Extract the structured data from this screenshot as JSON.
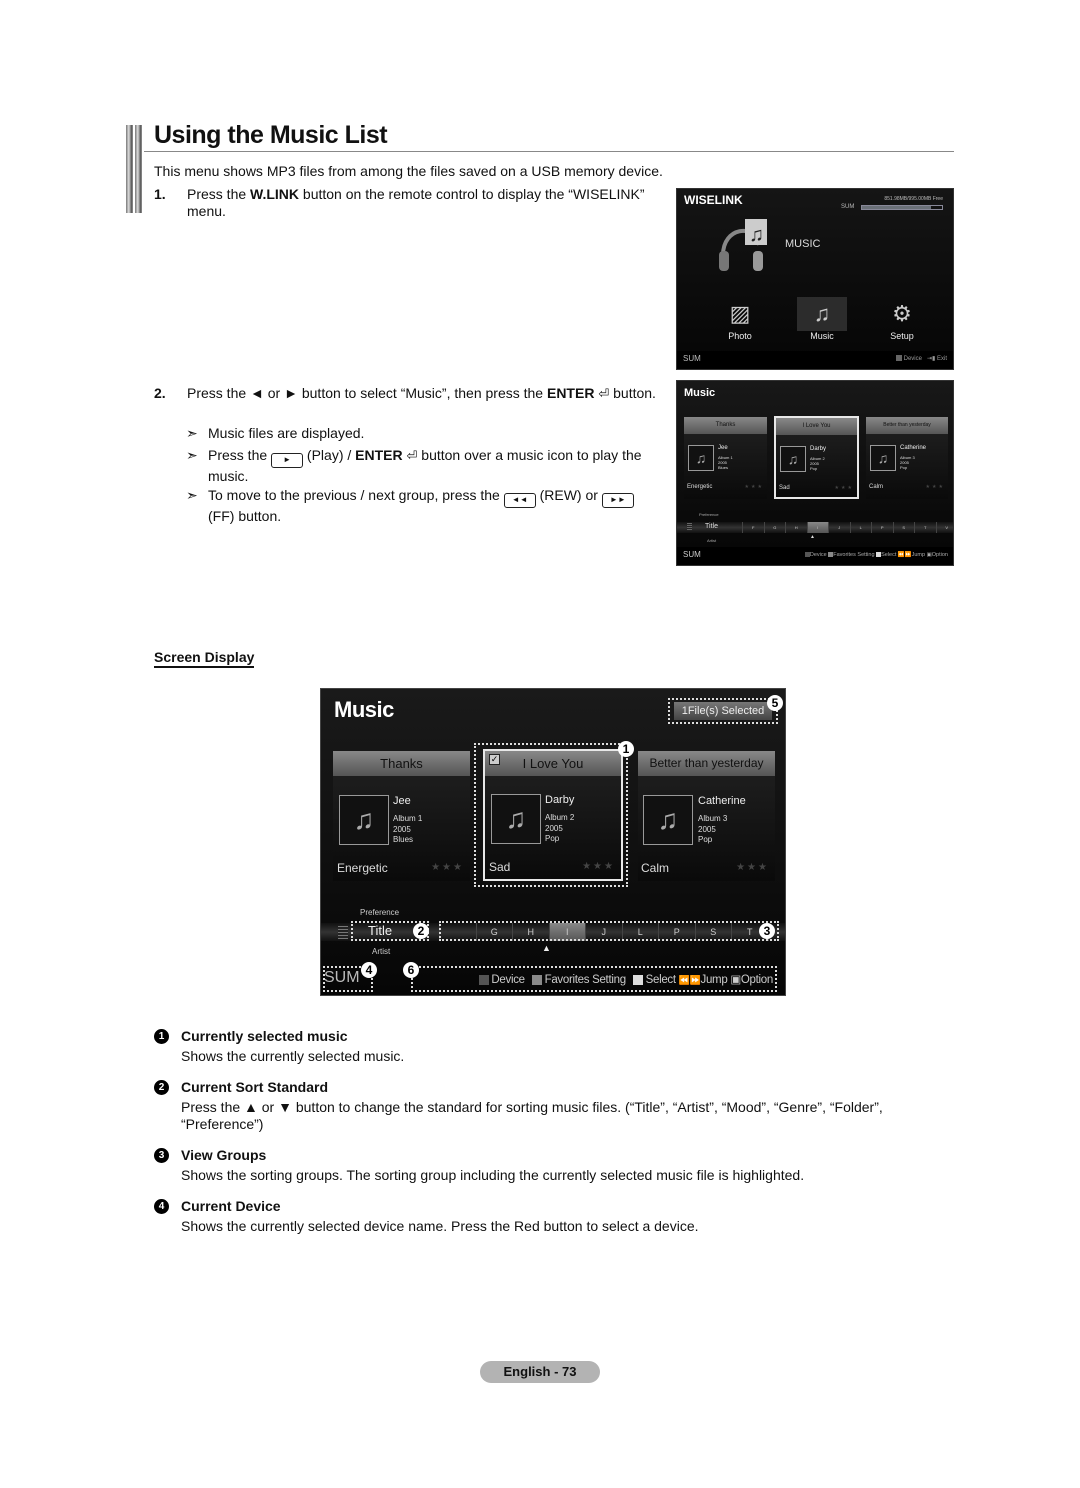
{
  "page": {
    "title": "Using the Music List",
    "intro": "This menu shows MP3 files from among the files saved on a USB memory device.",
    "screen_display_heading": "Screen Display",
    "footer": "English - 73"
  },
  "steps": [
    {
      "num": "1.",
      "text_pre": "Press the ",
      "bold": "W.LINK",
      "text_post": " button on the remote control to display the “WISELINK” menu."
    },
    {
      "num": "2.",
      "text_pre": "Press the ◄ or ► button to select “Music”, then press the ",
      "bold": "ENTER",
      "text_post": " button.",
      "notes": [
        {
          "pre": "Music files are displayed."
        },
        {
          "pre": "Press the ",
          "key": "►",
          "mid": " (Play) / ",
          "bold": "ENTER",
          "post": " button over a music icon to play the music."
        },
        {
          "pre": "To move to the previous / next group, press the ",
          "key": "◄◄",
          "mid": " (REW) or ",
          "key2": "►►",
          "post": " (FF) button."
        }
      ]
    }
  ],
  "wiselink_screen": {
    "brand": "WISELINK",
    "storage": "851.98MB/995.00MB Free",
    "storage_used_fraction": 0.86,
    "device_label": "SUM",
    "section": "MUSIC",
    "icons": [
      {
        "label": "Photo",
        "icon": "photo-icon",
        "selected": false
      },
      {
        "label": "Music",
        "icon": "music-note-icon",
        "selected": true
      },
      {
        "label": "Setup",
        "icon": "gear-icon",
        "selected": false
      }
    ],
    "footer_device": "SUM",
    "footer_buttons": [
      {
        "label": "Device",
        "icon": "red-square"
      },
      {
        "label": "Exit",
        "icon": "exit-icon"
      }
    ]
  },
  "music_screen": {
    "title": "Music",
    "selected_badge": "1File(s) Selected",
    "cards": [
      {
        "title": "Thanks",
        "artist": "Jee",
        "album": "Album 1",
        "year": "2005",
        "genre": "Blues",
        "mood": "Energetic",
        "stars": "★★★",
        "selected": false,
        "checked": false
      },
      {
        "title": "I Love You",
        "artist": "Darby",
        "album": "Album 2",
        "year": "2005",
        "genre": "Pop",
        "mood": "Sad",
        "stars": "★★★",
        "selected": true,
        "checked": true
      },
      {
        "title": "Better than yesterday",
        "artist": "Catherine",
        "album": "Album 3",
        "year": "2005",
        "genre": "Pop",
        "mood": "Calm",
        "stars": "★★★",
        "selected": false,
        "checked": false
      }
    ],
    "sort": {
      "prev": "Preference",
      "current": "Title",
      "next": "Artist"
    },
    "groups_small": [
      "F",
      "G",
      "H",
      "I",
      "J",
      "L",
      "P",
      "S",
      "T",
      "V"
    ],
    "groups_big": [
      "",
      "G",
      "H",
      "I",
      "J",
      "L",
      "P",
      "S",
      "T",
      ""
    ],
    "highlighted_group": "I",
    "device": "SUM",
    "footer_buttons": [
      {
        "label": "Device",
        "color": "#555555"
      },
      {
        "label": "Favorites Setting",
        "color": "#8a8a8a"
      },
      {
        "label": "Select",
        "color": "#dddddd"
      },
      {
        "label": "Jump",
        "icon": "rew-ff-icon"
      },
      {
        "label": "Option",
        "icon": "option-icon"
      }
    ],
    "callouts": [
      "1",
      "2",
      "3",
      "4",
      "5",
      "6"
    ]
  },
  "legend": [
    {
      "num": "1",
      "head": "Currently selected music",
      "desc": "Shows the currently selected music."
    },
    {
      "num": "2",
      "head": "Current Sort Standard",
      "desc": "Press the ▲ or ▼ button to change the standard for sorting music files. (“Title”, “Artist”, “Mood”, “Genre”, “Folder”, “Preference”)"
    },
    {
      "num": "3",
      "head": "View Groups",
      "desc": "Shows the sorting groups. The sorting group including the currently selected music file is highlighted."
    },
    {
      "num": "4",
      "head": "Current Device",
      "desc": "Shows the currently selected device name. Press the Red button to select a device."
    }
  ]
}
